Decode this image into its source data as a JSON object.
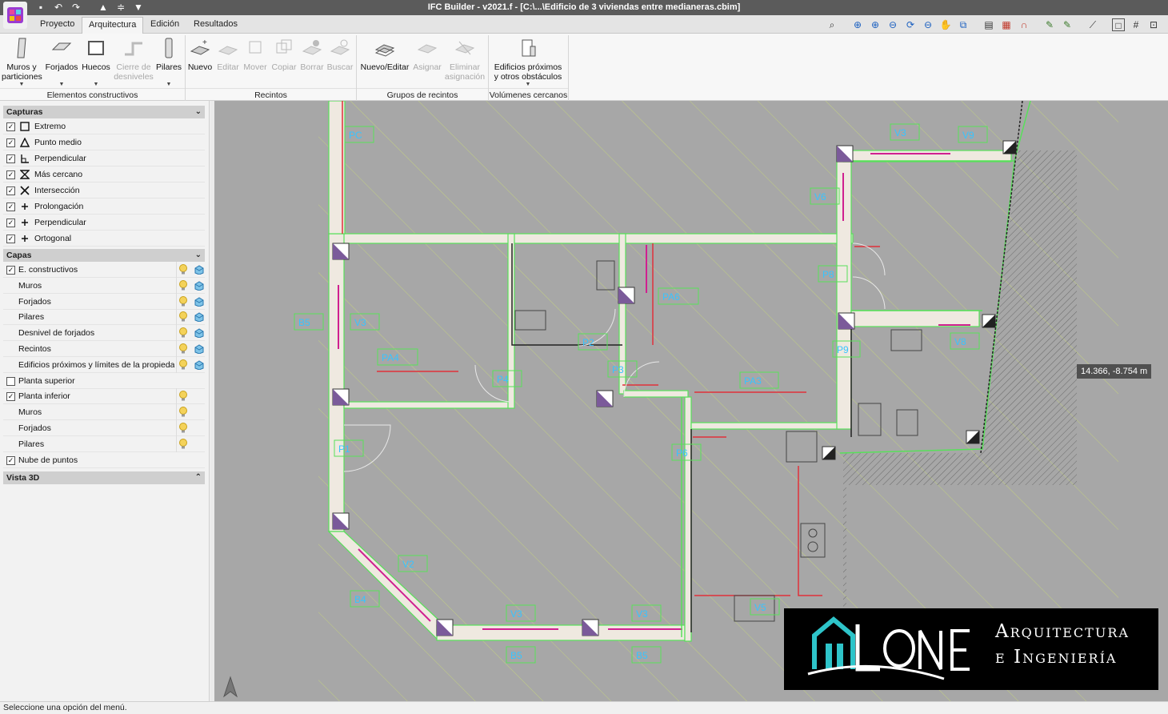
{
  "window": {
    "title": "IFC Builder - v2021.f - [C:\\...\\Edificio de 3 viviendas entre medianeras.cbim]"
  },
  "tabs": [
    {
      "label": "Proyecto",
      "active": false
    },
    {
      "label": "Arquitectura",
      "active": true
    },
    {
      "label": "Edición",
      "active": false
    },
    {
      "label": "Resultados",
      "active": false
    }
  ],
  "ribbon": {
    "groups": [
      "Elementos constructivos",
      "Recintos",
      "Grupos de recintos",
      "Volúmenes cercanos"
    ],
    "buttons": {
      "muros": "Muros y\nparticiones",
      "forjados": "Forjados",
      "huecos": "Huecos",
      "cierre": "Cierre de\ndesniveles",
      "pilares": "Pilares",
      "nuevo": "Nuevo",
      "editar": "Editar",
      "mover": "Mover",
      "copiar": "Copiar",
      "borrar": "Borrar",
      "buscar": "Buscar",
      "nuevo_editar": "Nuevo/Editar",
      "asignar": "Asignar",
      "eliminar": "Eliminar\nasignación",
      "edificios": "Edificios próximos\ny otros obstáculos"
    }
  },
  "panel": {
    "capturas": {
      "title": "Capturas",
      "items": [
        {
          "label": "Extremo",
          "checked": true,
          "icon": "square-snap-icon"
        },
        {
          "label": "Punto medio",
          "checked": true,
          "icon": "triangle-snap-icon"
        },
        {
          "label": "Perpendicular",
          "checked": true,
          "icon": "perpendicular-snap-icon"
        },
        {
          "label": "Más cercano",
          "checked": true,
          "icon": "hourglass-snap-icon"
        },
        {
          "label": "Intersección",
          "checked": true,
          "icon": "cross-snap-icon"
        },
        {
          "label": "Prolongación",
          "checked": true,
          "icon": "plus-snap-icon"
        },
        {
          "label": "Perpendicular",
          "checked": true,
          "icon": "plus-snap-icon"
        },
        {
          "label": "Ortogonal",
          "checked": true,
          "icon": "plus-snap-icon"
        }
      ]
    },
    "capas": {
      "title": "Capas",
      "items": [
        {
          "label": "E. constructivos",
          "checkbox": true,
          "checked": true,
          "cube": true
        },
        {
          "label": "Muros",
          "checkbox": false,
          "cube": true
        },
        {
          "label": "Forjados",
          "checkbox": false,
          "cube": true
        },
        {
          "label": "Pilares",
          "checkbox": false,
          "cube": true
        },
        {
          "label": "Desnivel de forjados",
          "checkbox": false,
          "cube": true
        },
        {
          "label": "Recintos",
          "checkbox": false,
          "cube": true
        },
        {
          "label": "Edificios próximos y límites de la propiedad",
          "checkbox": false,
          "cube": true
        },
        {
          "label": "Planta superior",
          "checkbox": true,
          "checked": false,
          "bulb": false
        },
        {
          "label": "Planta inferior",
          "checkbox": true,
          "checked": true,
          "cube": false
        },
        {
          "label": "Muros",
          "checkbox": false,
          "cube": false
        },
        {
          "label": "Forjados",
          "checkbox": false,
          "cube": false
        },
        {
          "label": "Pilares",
          "checkbox": false,
          "cube": false
        },
        {
          "label": "Nube de puntos",
          "checkbox": true,
          "checked": true,
          "bulb": false
        }
      ]
    },
    "vista3d": {
      "title": "Vista 3D"
    }
  },
  "viewport": {
    "coordinate_readout": "14.366, -8.754 m",
    "tags": [
      "PC",
      "V3",
      "V9",
      "V6",
      "PA6",
      "P8",
      "B5",
      "V3",
      "PA4",
      "P2",
      "P4",
      "P3",
      "PA3",
      "P9",
      "V8",
      "P1",
      "P6",
      "V2",
      "B4",
      "V3",
      "V3",
      "B5",
      "B5",
      "V5"
    ]
  },
  "logo": {
    "line1": "Arquitectura",
    "line2": "e Ingeniería"
  },
  "status": {
    "text": "Seleccione una opción del menú."
  },
  "colors": {
    "titlebar": "#5b5b5b",
    "viewport_bg": "#a7a7a7",
    "wall_outline": "#58e05a",
    "tag_text": "#38c4ff",
    "opening": "#d02090"
  }
}
